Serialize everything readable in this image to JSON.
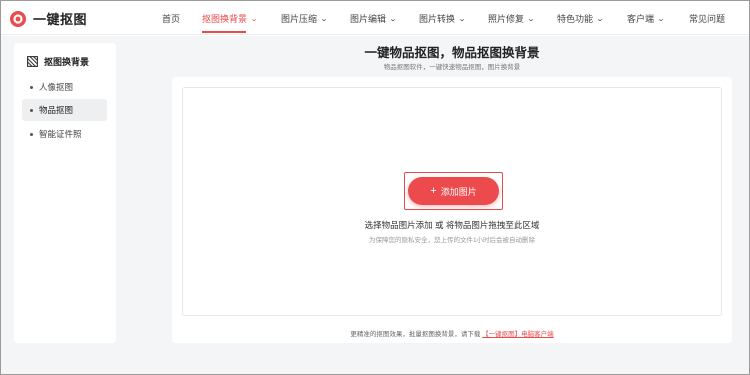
{
  "brand": {
    "name": "一键抠图",
    "accent": "#e94a4a"
  },
  "nav": {
    "items": [
      {
        "label": "首页",
        "has_dropdown": false,
        "active": false
      },
      {
        "label": "抠图换背景",
        "has_dropdown": true,
        "active": true
      },
      {
        "label": "图片压缩",
        "has_dropdown": true,
        "active": false
      },
      {
        "label": "图片编辑",
        "has_dropdown": true,
        "active": false
      },
      {
        "label": "图片转换",
        "has_dropdown": true,
        "active": false
      },
      {
        "label": "照片修复",
        "has_dropdown": true,
        "active": false
      },
      {
        "label": "特色功能",
        "has_dropdown": true,
        "active": false
      },
      {
        "label": "客户端",
        "has_dropdown": true,
        "active": false
      },
      {
        "label": "常见问题",
        "has_dropdown": false,
        "active": false
      }
    ]
  },
  "sidebar": {
    "title": "抠图换背景",
    "title_icon": "crop-pattern-icon",
    "items": [
      {
        "label": "人像抠图",
        "active": false
      },
      {
        "label": "物品抠图",
        "active": true
      },
      {
        "label": "智能证件照",
        "active": false
      }
    ]
  },
  "main": {
    "title": "一键物品抠图，物品抠图换背景",
    "subtitle": "物品抠图软件，一键快速物品抠图，图片换背景",
    "upload_button": "添加图片",
    "upload_icon": "plus-icon",
    "drop_text": "选择物品图片添加 或 将物品图片拖拽至此区域",
    "drop_note": "为保障您的隐私安全，您上传的文件1小时后会被自动删除",
    "footer_prefix": "更精准的抠图效果，批量抠图换背景，请下载",
    "footer_link": "【一键抠图】电脑客户端"
  }
}
